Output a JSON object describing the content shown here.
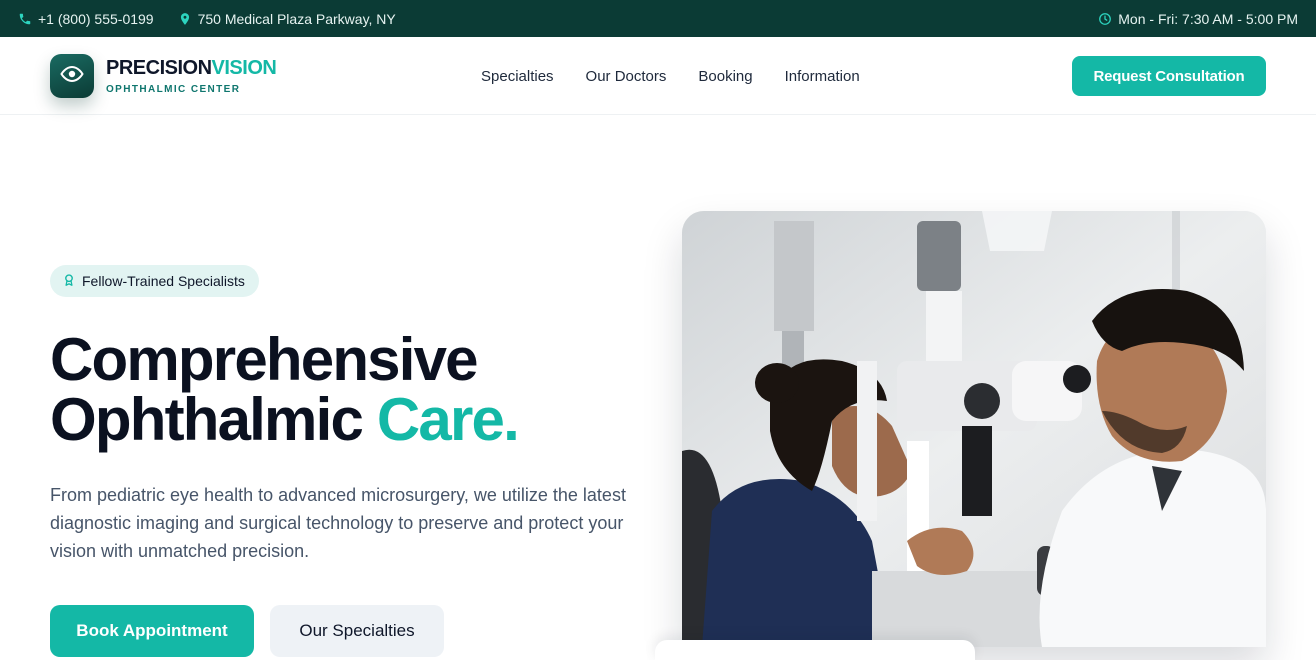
{
  "topbar": {
    "phone": "+1 (800) 555-0199",
    "address": "750 Medical Plaza Parkway, NY",
    "hours": "Mon - Fri: 7:30 AM - 5:00 PM",
    "phone_icon": "phone-icon",
    "location_icon": "map-pin-icon",
    "clock_icon": "clock-icon"
  },
  "brand": {
    "name_part1": "PRECISION",
    "name_part2": "VISION",
    "subtitle": "OPHTHALMIC CENTER",
    "logo_icon": "eye-icon"
  },
  "nav": {
    "items": [
      "Specialties",
      "Our Doctors",
      "Booking",
      "Information"
    ]
  },
  "header": {
    "cta_label": "Request Consultation"
  },
  "hero": {
    "badge": "Fellow-Trained Specialists",
    "badge_icon": "award-icon",
    "title_line1": "Comprehensive",
    "title_line2_a": "Ophthalmic ",
    "title_line2_b": "Care",
    "title_line2_c": ".",
    "description": "From pediatric eye health to advanced microsurgery, we utilize the latest diagnostic imaging and surgical technology to preserve and protect your vision with unmatched precision.",
    "primary_button": "Book Appointment",
    "secondary_button": "Our Specialties"
  },
  "colors": {
    "topbar_bg": "#0b3b35",
    "accent": "#14b8a6",
    "heading": "#0b1120",
    "body_text": "#475569"
  }
}
